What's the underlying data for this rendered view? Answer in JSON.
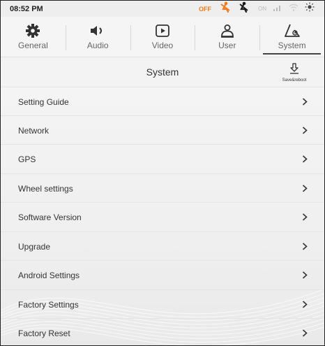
{
  "status_bar": {
    "time": "08:52 PM",
    "off_label": "OFF",
    "on_label": "ON",
    "accent_color": "#f07a1e",
    "icons": [
      "mute-speaker-icon",
      "seatbelt-off-icon",
      "seatbelt-on-icon",
      "signal-icon",
      "wifi-icon",
      "brightness-icon"
    ]
  },
  "tabs": [
    {
      "label": "General",
      "icon": "gear-icon",
      "active": false
    },
    {
      "label": "Audio",
      "icon": "speaker-icon",
      "active": false
    },
    {
      "label": "Video",
      "icon": "play-icon",
      "active": false
    },
    {
      "label": "User",
      "icon": "user-icon",
      "active": false
    },
    {
      "label": "System",
      "icon": "system-settings-icon",
      "active": true
    }
  ],
  "header": {
    "title": "System",
    "save_label": "Save&reboot"
  },
  "menu": {
    "items": [
      {
        "label": "Setting Guide"
      },
      {
        "label": "Network"
      },
      {
        "label": "GPS"
      },
      {
        "label": "Wheel settings"
      },
      {
        "label": "Software Version"
      },
      {
        "label": "Upgrade"
      },
      {
        "label": "Android Settings"
      },
      {
        "label": "Factory Settings"
      },
      {
        "label": "Factory Reset"
      }
    ],
    "chevron": ">"
  }
}
